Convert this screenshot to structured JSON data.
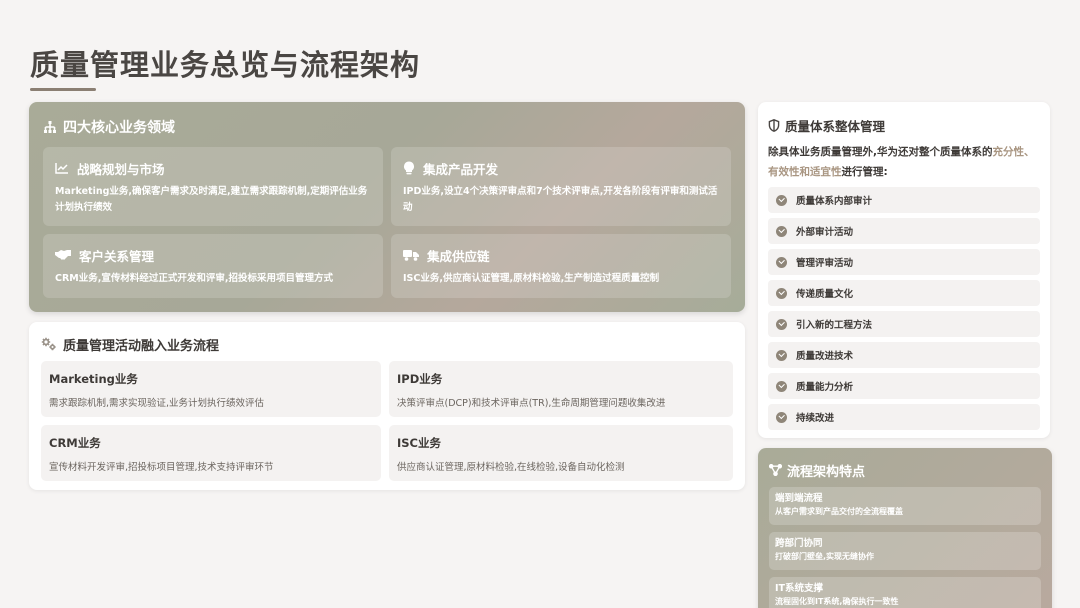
{
  "page": {
    "title": "质量管理业务总览与流程架构"
  },
  "core": {
    "header": "四大核心业务领域",
    "header_icon": "sitemap-icon",
    "cards": [
      {
        "title": "战略规划与市场",
        "icon": "line-chart-icon",
        "desc": "Marketing业务,确保客户需求及时满足,建立需求跟踪机制,定期评估业务计划执行绩效"
      },
      {
        "title": "集成产品开发",
        "icon": "lightbulb-icon",
        "desc": "IPD业务,设立4个决策评审点和7个技术评审点,开发各阶段有评审和测试活动"
      },
      {
        "title": "客户关系管理",
        "icon": "handshake-icon",
        "desc": "CRM业务,宣传材料经过正式开发和评审,招投标采用项目管理方式"
      },
      {
        "title": "集成供应链",
        "icon": "truck-icon",
        "desc": "ISC业务,供应商认证管理,原材料检验,生产制造过程质量控制"
      }
    ]
  },
  "activity": {
    "header": "质量管理活动融入业务流程",
    "header_icon": "gears-icon",
    "cards": [
      {
        "title": "Marketing业务",
        "desc": "需求跟踪机制,需求实现验证,业务计划执行绩效评估"
      },
      {
        "title": "IPD业务",
        "desc": "决策评审点(DCP)和技术评审点(TR),生命周期管理问题收集改进"
      },
      {
        "title": "CRM业务",
        "desc": "宣传材料开发评审,招投标项目管理,技术支持评审环节"
      },
      {
        "title": "ISC业务",
        "desc": "供应商认证管理,原材料检验,在线检验,设备自动化检测"
      }
    ]
  },
  "system": {
    "header": "质量体系整体管理",
    "header_icon": "shield-icon",
    "intro_prefix": "除具体业务质量管理外,华为还对整个质量体系的",
    "intro_highlight": "充分性、有效性和适宜性",
    "intro_suffix": "进行管理:",
    "highlight_color": "#a99682",
    "items": [
      "质量体系内部审计",
      "外部审计活动",
      "管理评审活动",
      "传递质量文化",
      "引入新的工程方法",
      "质量改进技术",
      "质量能力分析",
      "持续改进"
    ]
  },
  "arch": {
    "header": "流程架构特点",
    "header_icon": "network-icon",
    "items": [
      {
        "title": "端到端流程",
        "desc": "从客户需求到产品交付的全流程覆盖"
      },
      {
        "title": "跨部门协同",
        "desc": "打破部门壁垒,实现无缝协作"
      },
      {
        "title": "IT系统支撑",
        "desc": "流程固化到IT系统,确保执行一致性"
      }
    ]
  },
  "colors": {
    "accent": "#8b7f73",
    "panel_sage": "#a9ab98",
    "check": "#8f8679"
  }
}
